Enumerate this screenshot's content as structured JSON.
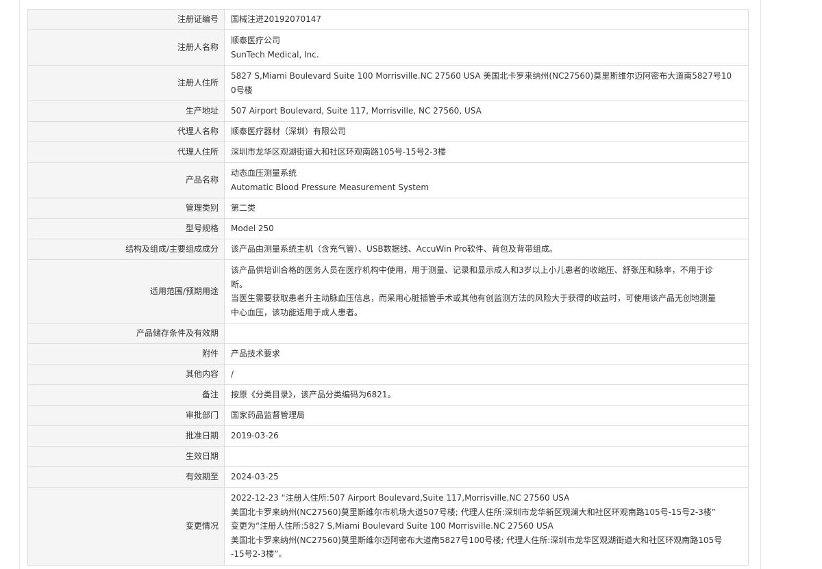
{
  "rows": [
    {
      "label": "注册证编号",
      "lines": [
        "国械注进20192070147"
      ]
    },
    {
      "label": "注册人名称",
      "lines": [
        "顺泰医疗公司",
        "SunTech Medical, Inc."
      ]
    },
    {
      "label": "注册人住所",
      "lines": [
        "5827 S,Miami Boulevard Suite 100 Morrisville.NC 27560 USA 美国北卡罗来纳州(NC27560)莫里斯维尔迈阿密布大道南5827号10",
        "0号楼"
      ]
    },
    {
      "label": "生产地址",
      "lines": [
        "507 Airport Boulevard, Suite 117, Morrisville, NC 27560, USA"
      ]
    },
    {
      "label": "代理人名称",
      "lines": [
        "顺泰医疗器材（深圳）有限公司"
      ]
    },
    {
      "label": "代理人住所",
      "lines": [
        "深圳市龙华区观湖街道大和社区环观南路105号-15号2-3楼"
      ]
    },
    {
      "label": "产品名称",
      "lines": [
        "动态血压测量系统",
        "Automatic Blood Pressure Measurement System"
      ]
    },
    {
      "label": "管理类别",
      "lines": [
        "第二类"
      ]
    },
    {
      "label": "型号规格",
      "lines": [
        "Model 250"
      ]
    },
    {
      "label": "结构及组成/主要组成成分",
      "lines": [
        "该产品由测量系统主机（含充气管）、USB数据线、AccuWin Pro软件、背包及背带组成。"
      ]
    },
    {
      "label": "适用范围/预期用途",
      "lines": [
        "该产品供培训合格的医务人员在医疗机构中使用，用于测量、记录和显示成人和3岁以上小儿患者的收缩压、舒张压和脉率，不用于诊",
        "断。",
        "当医生需要获取患者升主动脉血压信息，而采用心脏插管手术或其他有创监测方法的风险大于获得的收益时，可使用该产品无创地测量",
        "中心血压，该功能适用于成人患者。"
      ]
    },
    {
      "label": "产品储存条件及有效期",
      "lines": []
    },
    {
      "label": "附件",
      "lines": [
        "产品技术要求"
      ]
    },
    {
      "label": "其他内容",
      "lines": [
        "/"
      ]
    },
    {
      "label": "备注",
      "lines": [
        "按原《分类目录》，该产品分类编码为6821。"
      ]
    },
    {
      "label": "审批部门",
      "lines": [
        "国家药品监督管理局"
      ]
    },
    {
      "label": "批准日期",
      "lines": [
        "2019-03-26"
      ]
    },
    {
      "label": "生效日期",
      "lines": []
    },
    {
      "label": "有效期至",
      "lines": [
        "2024-03-25"
      ]
    },
    {
      "label": "变更情况",
      "lines": [
        "2022-12-23 “注册人住所:507 Airport Boulevard,Suite 117,Morrisville,NC 27560 USA",
        "美国北卡罗来纳州(NC27560)莫里斯维尔市机场大道507号楼; 代理人住所:深圳市龙华新区观澜大和社区环观南路105号-15号2-3楼”",
        "变更为“注册人住所:5827 S,Miami Boulevard Suite 100 Morrisville.NC 27560 USA",
        "美国北卡罗来纳州(NC27560)莫里斯维尔迈阿密布大道南5827号100号楼; 代理人住所:深圳市龙华区观湖街道大和社区环观南路105号",
        "-15号2-3楼”。"
      ]
    }
  ]
}
